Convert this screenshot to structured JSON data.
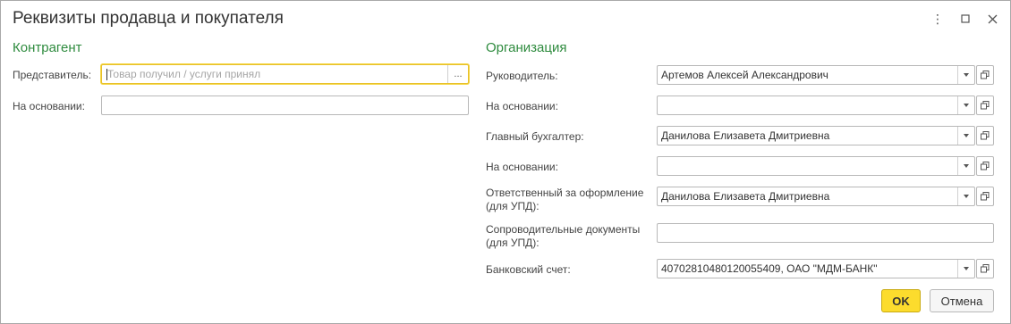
{
  "window": {
    "title": "Реквизиты продавца и покупателя",
    "more_icon": "⋮",
    "maximize_icon": "□",
    "close_icon": "✕"
  },
  "left": {
    "section_title": "Контрагент",
    "representative_label": "Представитель:",
    "representative_value": "",
    "representative_placeholder": "Товар получил / услуги принял",
    "select_button": "...",
    "basis_label": "На основании:",
    "basis_value": ""
  },
  "right": {
    "section_title": "Организация",
    "rows": [
      {
        "label": "Руководитель:",
        "value": "Артемов Алексей Александрович"
      },
      {
        "label": "На основании:",
        "value": ""
      },
      {
        "label": "Главный бухгалтер:",
        "value": "Данилова Елизавета Дмитриевна"
      },
      {
        "label": "На основании:",
        "value": ""
      },
      {
        "label_line1": "Ответственный за оформление",
        "label_line2": "(для УПД):",
        "value": "Данилова Елизавета Дмитриевна"
      },
      {
        "label_line1": "Сопроводительные документы",
        "label_line2": "(для УПД):",
        "value": ""
      },
      {
        "label": "Банковский счет:",
        "value": "40702810480120055409, ОАО \"МДМ-БАНК\""
      }
    ]
  },
  "buttons": {
    "ok": "OK",
    "cancel": "Отмена"
  },
  "colors": {
    "section_title": "#2e8b3e",
    "ok_button": "#fcdc2d",
    "focus_border": "#e8c12a"
  }
}
